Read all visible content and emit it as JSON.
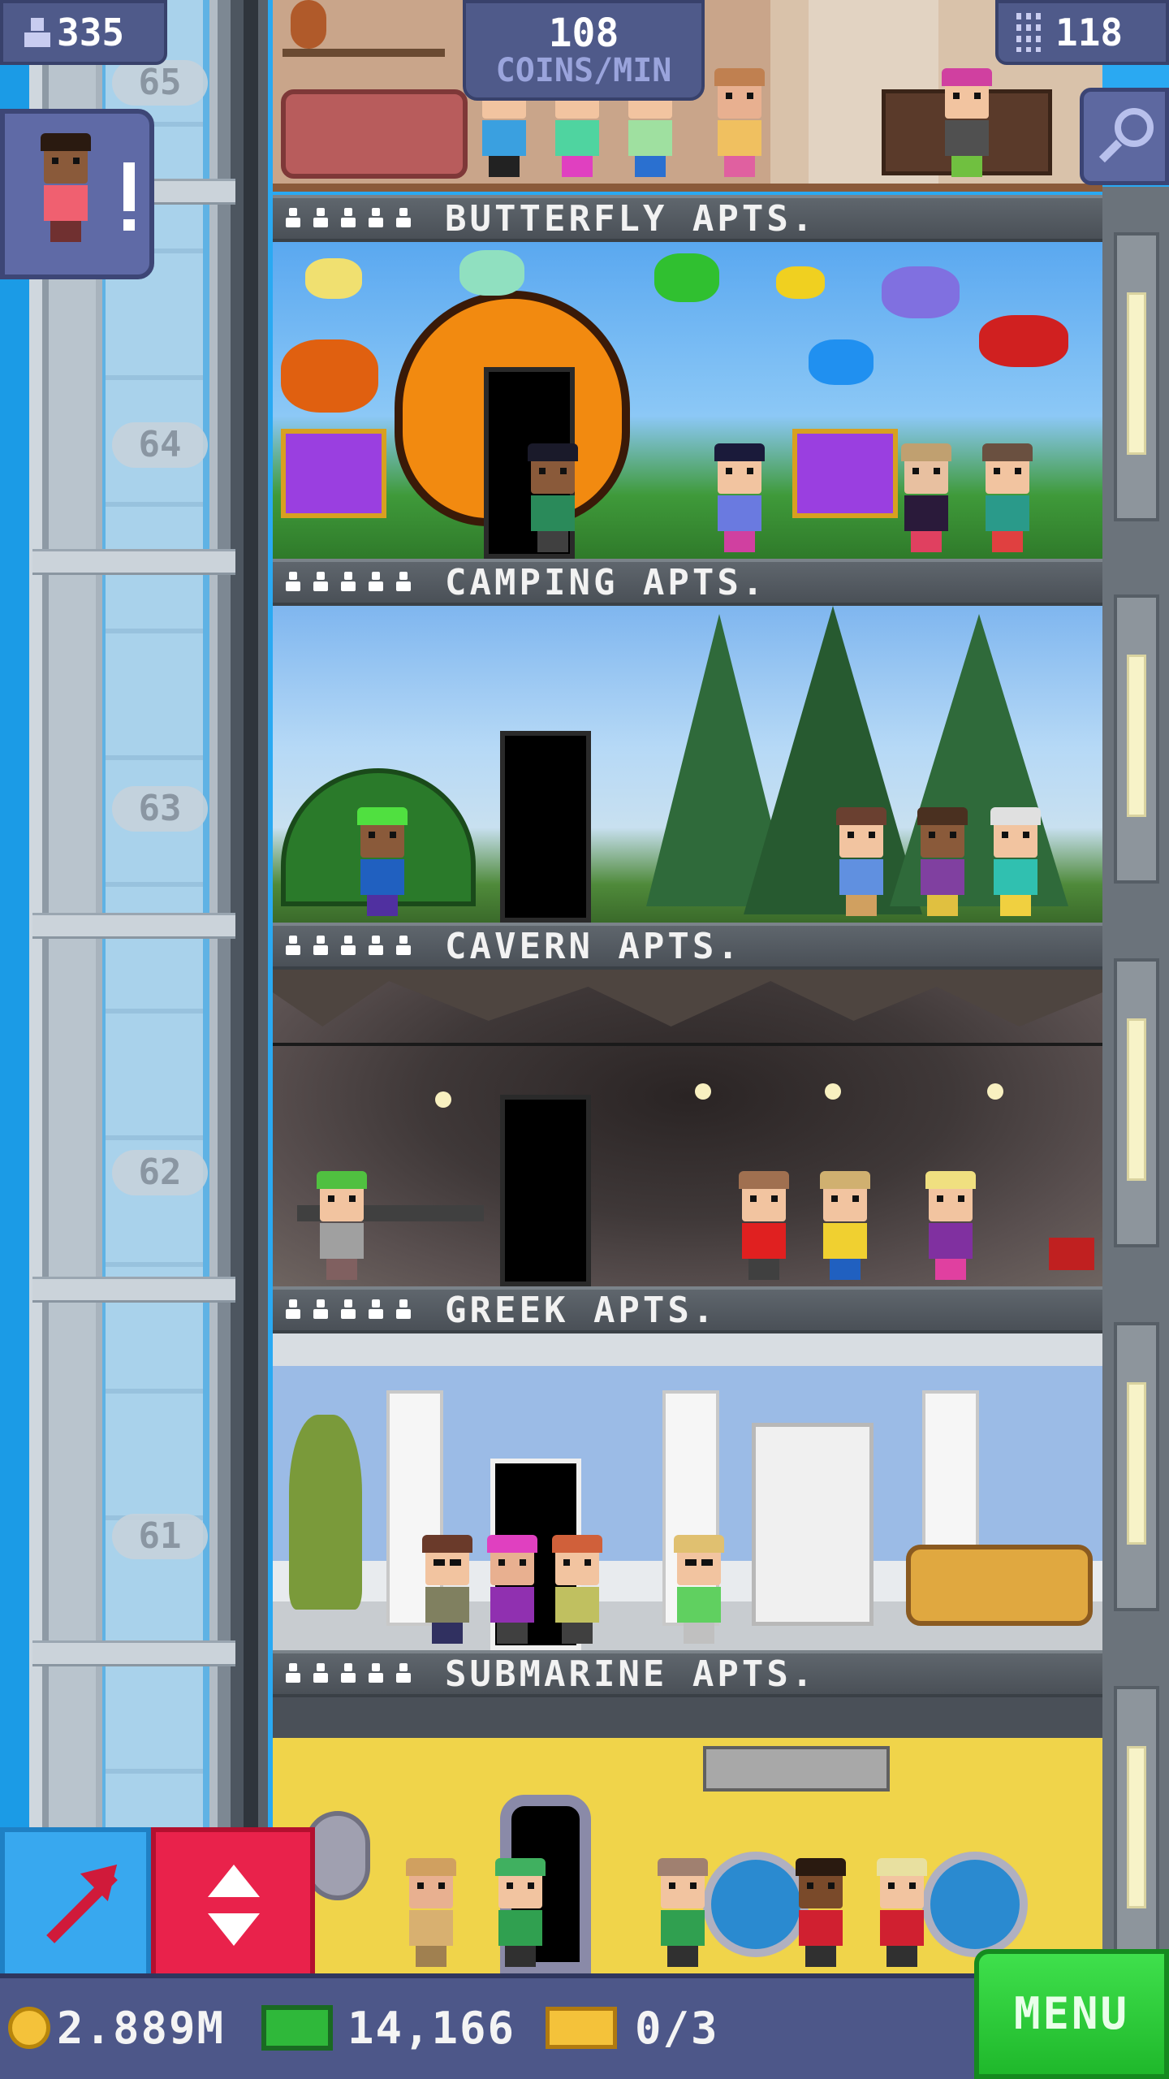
{
  "hud": {
    "population": "335",
    "coins_per_min_value": "108",
    "coins_per_min_label": "COINS/MIN",
    "floors": "118"
  },
  "shaft": {
    "floor_numbers": [
      "65",
      "64",
      "63",
      "62",
      "61"
    ]
  },
  "floors": [
    {
      "name": "BUTTERFLY APTS.",
      "pips": 5
    },
    {
      "name": "CAMPING APTS.",
      "pips": 5
    },
    {
      "name": "CAVERN APTS.",
      "pips": 5
    },
    {
      "name": "GREEK APTS.",
      "pips": 5
    },
    {
      "name": "SUBMARINE APTS.",
      "pips": 5
    }
  ],
  "bottom": {
    "coins": "2.889M",
    "bux": "14,166",
    "tickets": "0/3",
    "menu_label": "MENU"
  },
  "colors": {
    "sky": "#2aa9f2",
    "hud": "#4f5a8a",
    "menu": "#2bcc37",
    "elevator_button": "#e9224b",
    "arrow_button": "#38a8ef"
  },
  "icons": {
    "population": "person-icon",
    "floors": "building-icon",
    "search": "magnifier-icon",
    "coins": "coin-icon",
    "bux": "cash-icon",
    "tickets": "ticket-icon"
  }
}
